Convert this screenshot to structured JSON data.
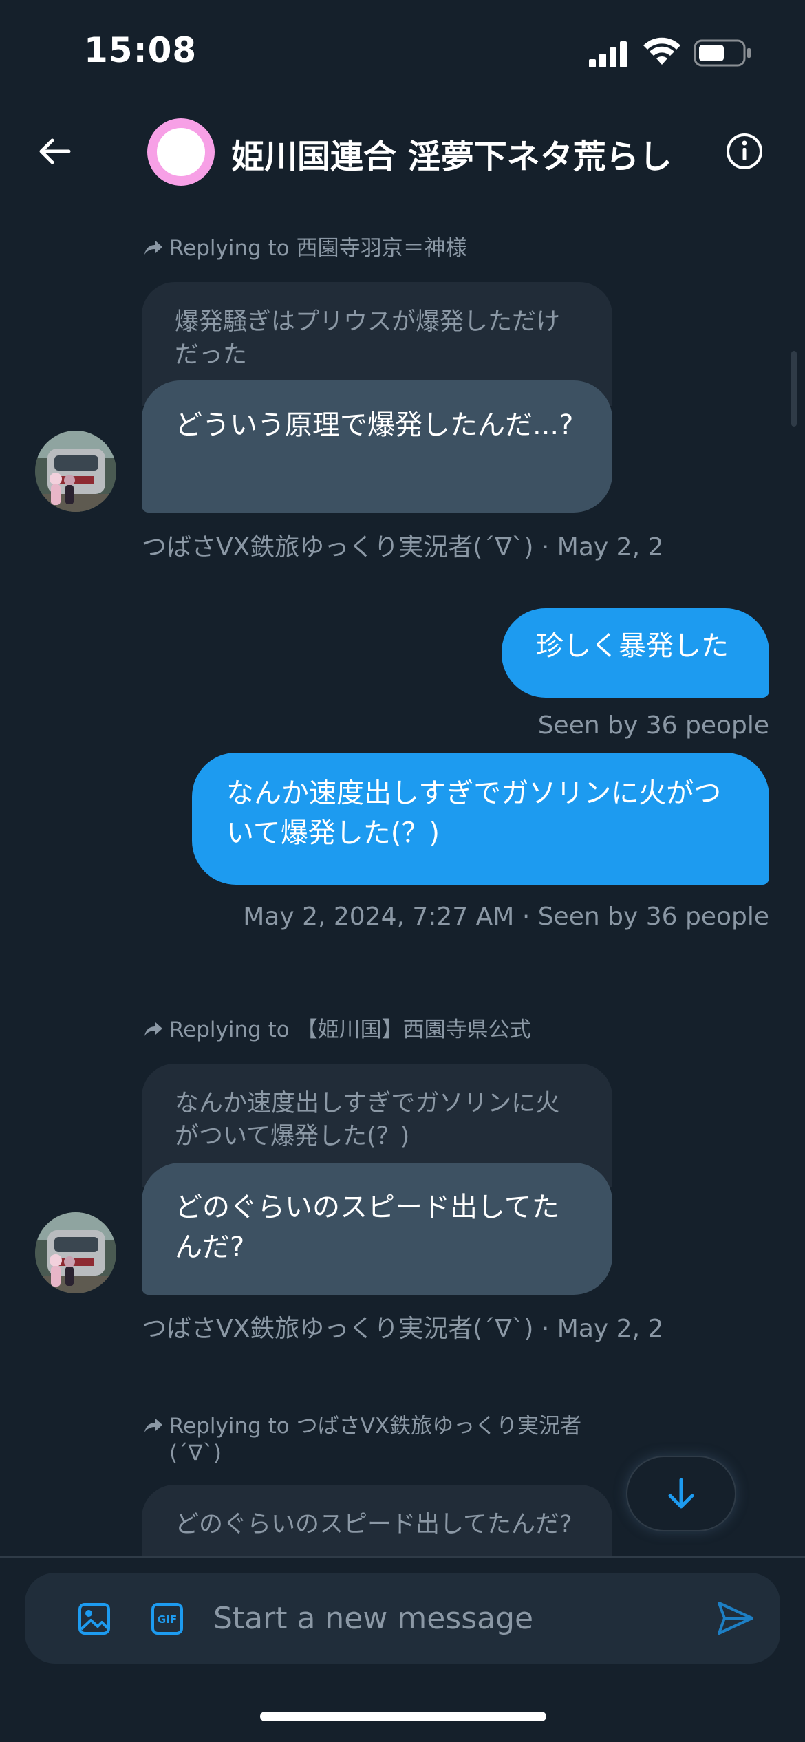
{
  "status_bar": {
    "time": "15:08"
  },
  "header": {
    "title": "姫川国連合 淫夢下ネタ荒らし"
  },
  "messages": [
    {
      "reply_to": "Replying to 西園寺羽京＝神様",
      "quoted": "爆発騒ぎはプリウスが爆発しただけだった",
      "text": "どういう原理で爆発したんだ...?",
      "meta": "つばさVX鉄旅ゆっくり実況者(´∇`) · May 2, 2"
    },
    {
      "text": "珍しく暴発した",
      "meta": "Seen by 36 people"
    },
    {
      "text": "なんか速度出しすぎでガソリンに火がついて爆発した(？)",
      "meta": "May 2, 2024, 7:27 AM · Seen by 36 people"
    },
    {
      "reply_to": "Replying to 【姫川国】西園寺県公式",
      "quoted": "なんか速度出しすぎでガソリンに火がついて爆発した(？)",
      "text": "どのぐらいのスピード出してたんだ?",
      "meta": "つばさVX鉄旅ゆっくり実況者(´∇`) · May 2, 2"
    },
    {
      "reply_to": "Replying to つばさVX鉄旅ゆっくり実況者(´∇`)",
      "quoted": "どのぐらいのスピード出してたんだ?"
    }
  ],
  "composer": {
    "placeholder": "Start a new message",
    "gif_label": "GIF"
  },
  "colors": {
    "background": "#15202b",
    "outgoing_bubble": "#1d9bf0",
    "incoming_bubble": "#3d5162",
    "quoted_bubble": "#212c38",
    "secondary_text": "#8b98a5"
  },
  "icons": {
    "back": "arrow-left-icon",
    "info": "info-icon",
    "reply": "reply-arrow-icon",
    "scroll_down": "arrow-down-icon",
    "image": "image-icon",
    "gif": "gif-icon",
    "send": "send-icon"
  }
}
